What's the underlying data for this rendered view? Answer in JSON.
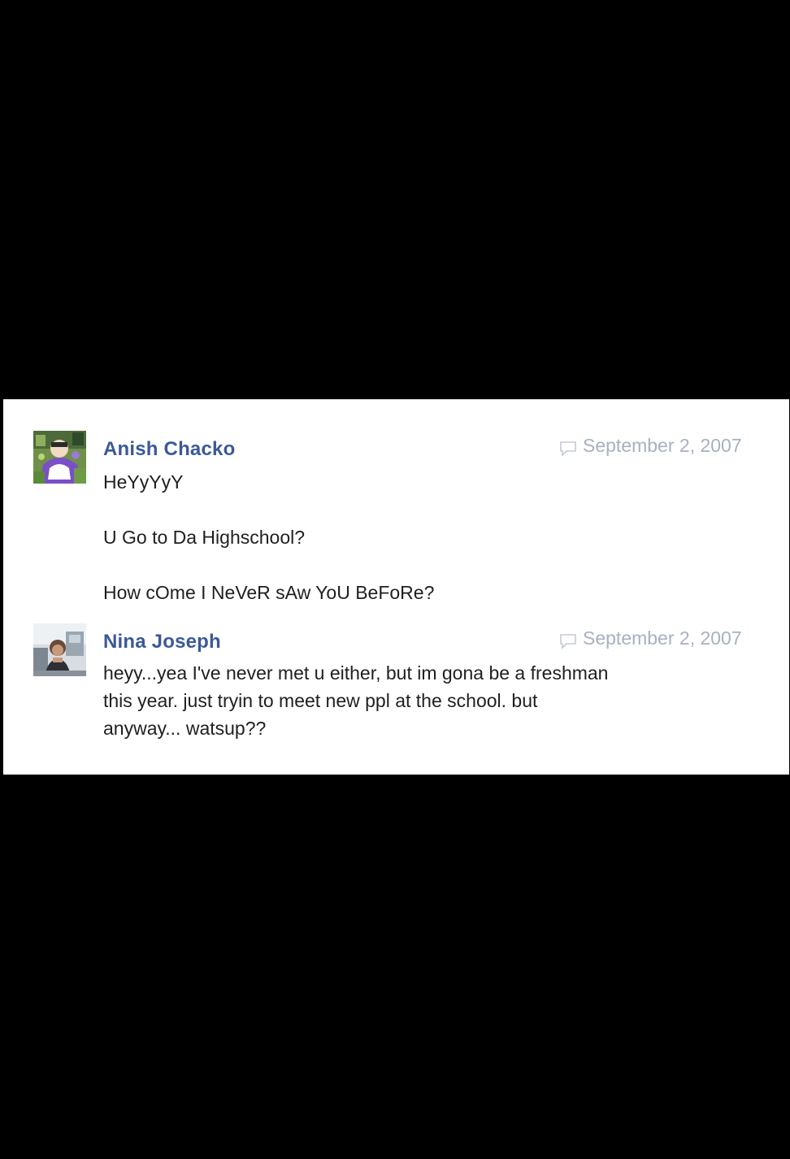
{
  "posts": [
    {
      "author": "Anish Chacko",
      "date": "September 2, 2007",
      "lines": [
        "HeYyYyY",
        "U Go to Da Highschool?",
        "How cOme I NeVeR sAw YoU BeFoRe?"
      ],
      "avatar_icon": "profile-photo-purple-collage"
    },
    {
      "author": "Nina Joseph",
      "date": "September 2, 2007",
      "lines": [
        "heyy...yea I've never met u either, but im gona be a freshman",
        "this year. just tryin to meet new ppl at the school. but",
        "anyway... watsup??"
      ],
      "avatar_icon": "profile-photo-person-office"
    }
  ],
  "colors": {
    "author_link": "#3b5998",
    "date": "#a8b0c0",
    "body_text": "#1f1f1f",
    "background": "#000000",
    "card": "#ffffff"
  }
}
